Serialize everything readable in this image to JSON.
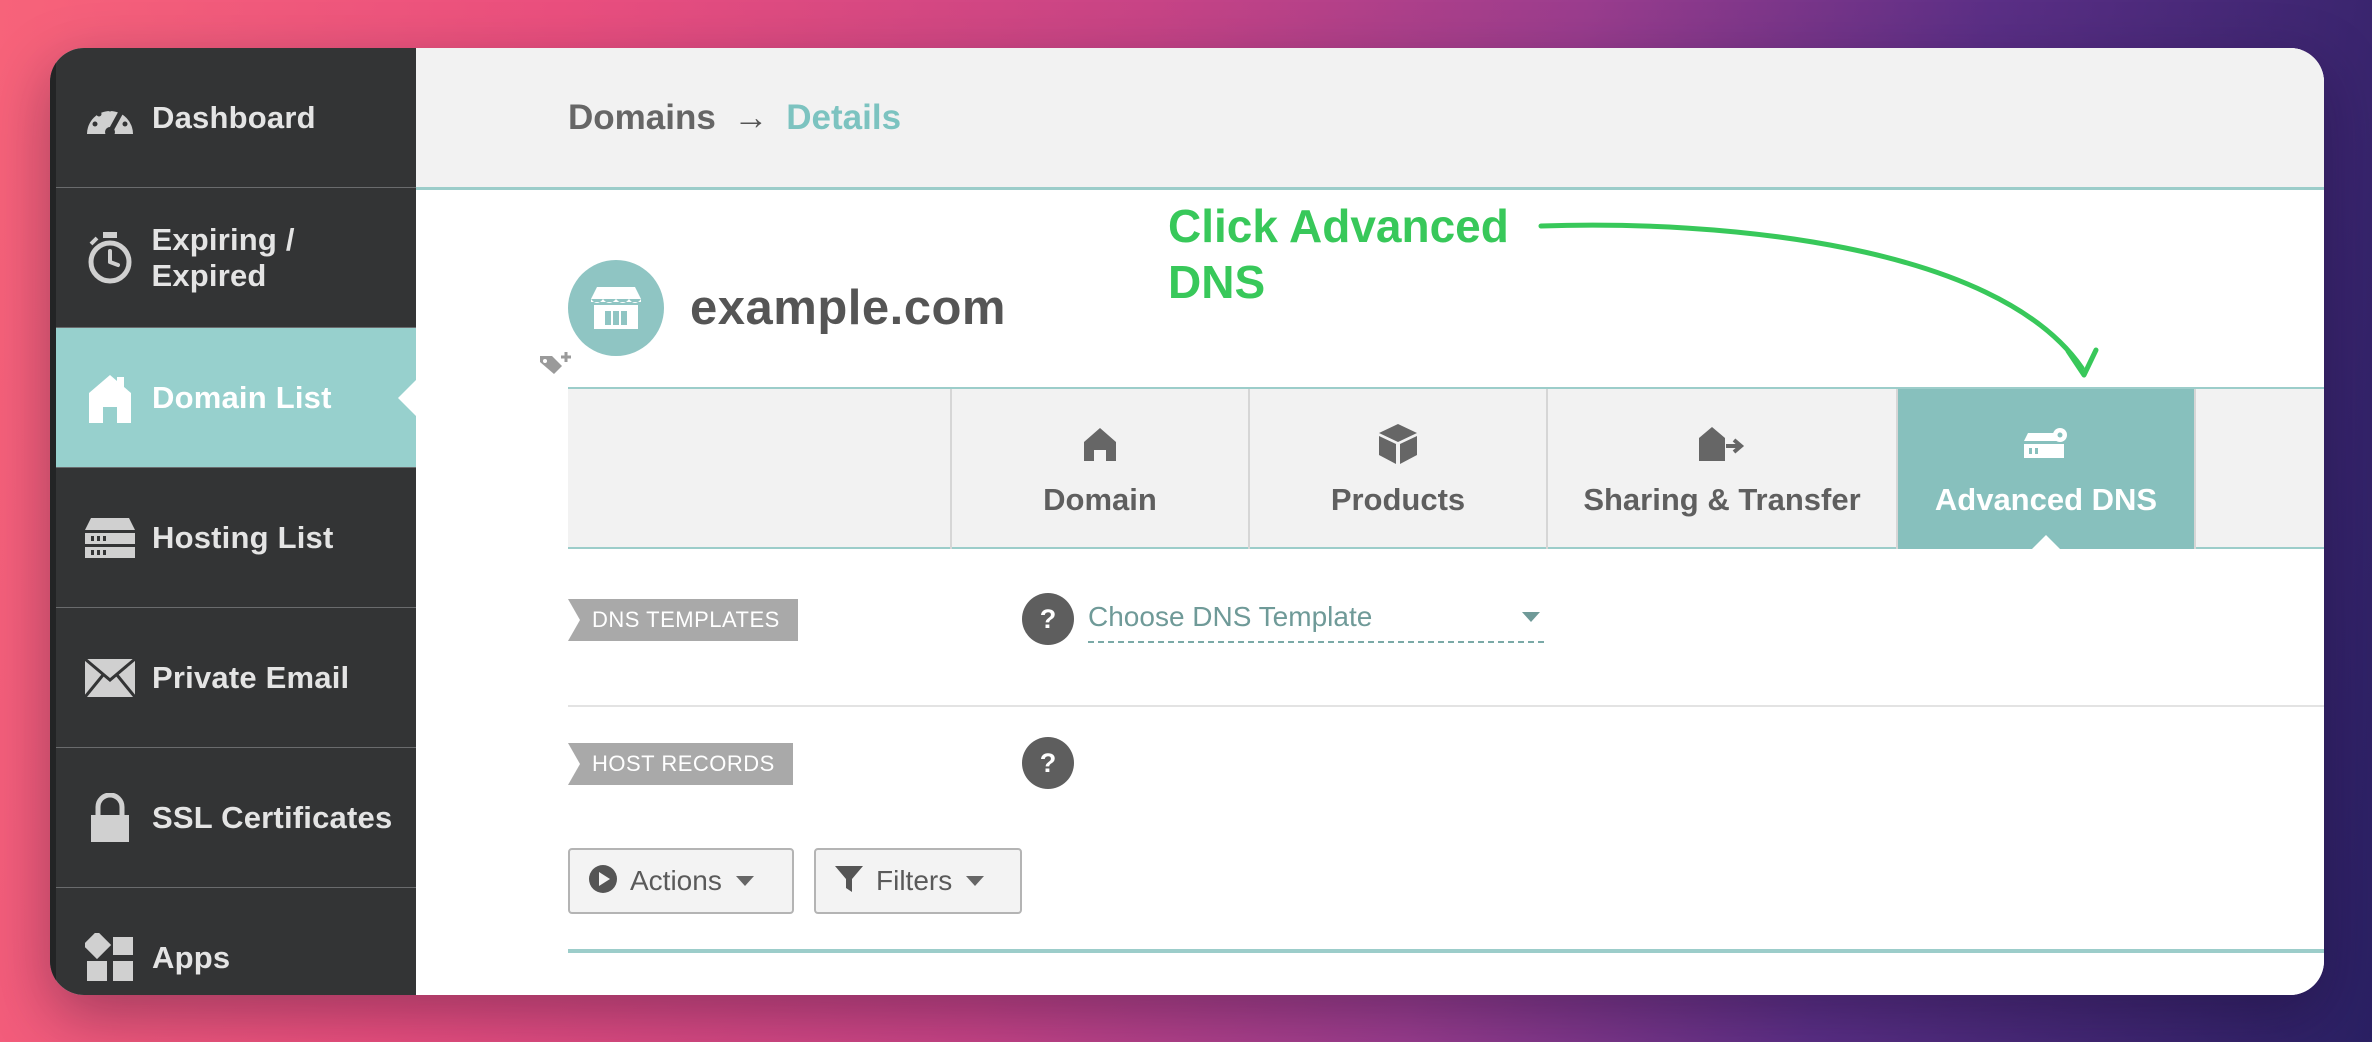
{
  "sidebar": {
    "items": [
      {
        "label": "Dashboard",
        "icon": "speedometer-icon"
      },
      {
        "label": "Expiring / Expired",
        "icon": "timer-icon"
      },
      {
        "label": "Domain List",
        "icon": "home-icon",
        "active": true
      },
      {
        "label": "Hosting List",
        "icon": "server-icon"
      },
      {
        "label": "Private Email",
        "icon": "envelope-icon"
      },
      {
        "label": "SSL Certificates",
        "icon": "lock-icon"
      },
      {
        "label": "Apps",
        "icon": "apps-grid-icon"
      }
    ]
  },
  "breadcrumb": {
    "parent": "Domains",
    "separator": "→",
    "current": "Details"
  },
  "domain": {
    "name": "example.com",
    "avatar_icon": "storefront-icon",
    "tag_icon": "add-tag-icon"
  },
  "annotation": {
    "line1": "Click Advanced",
    "line2": "DNS",
    "color": "#38c85a"
  },
  "tabs": [
    {
      "label": "Domain",
      "icon": "home-icon"
    },
    {
      "label": "Products",
      "icon": "box-icon"
    },
    {
      "label": "Sharing & Transfer",
      "icon": "house-arrow-icon"
    },
    {
      "label": "Advanced DNS",
      "icon": "server-gear-icon",
      "active": true
    }
  ],
  "dns_templates": {
    "label": "DNS TEMPLATES",
    "help": "?",
    "placeholder": "Choose DNS Template"
  },
  "host_records": {
    "label": "HOST RECORDS",
    "help": "?"
  },
  "toolbar": {
    "actions_label": "Actions",
    "filters_label": "Filters"
  },
  "colors": {
    "accent": "#97d0cd",
    "active_tab": "#87c0bd",
    "sidebar_bg": "#333435"
  }
}
